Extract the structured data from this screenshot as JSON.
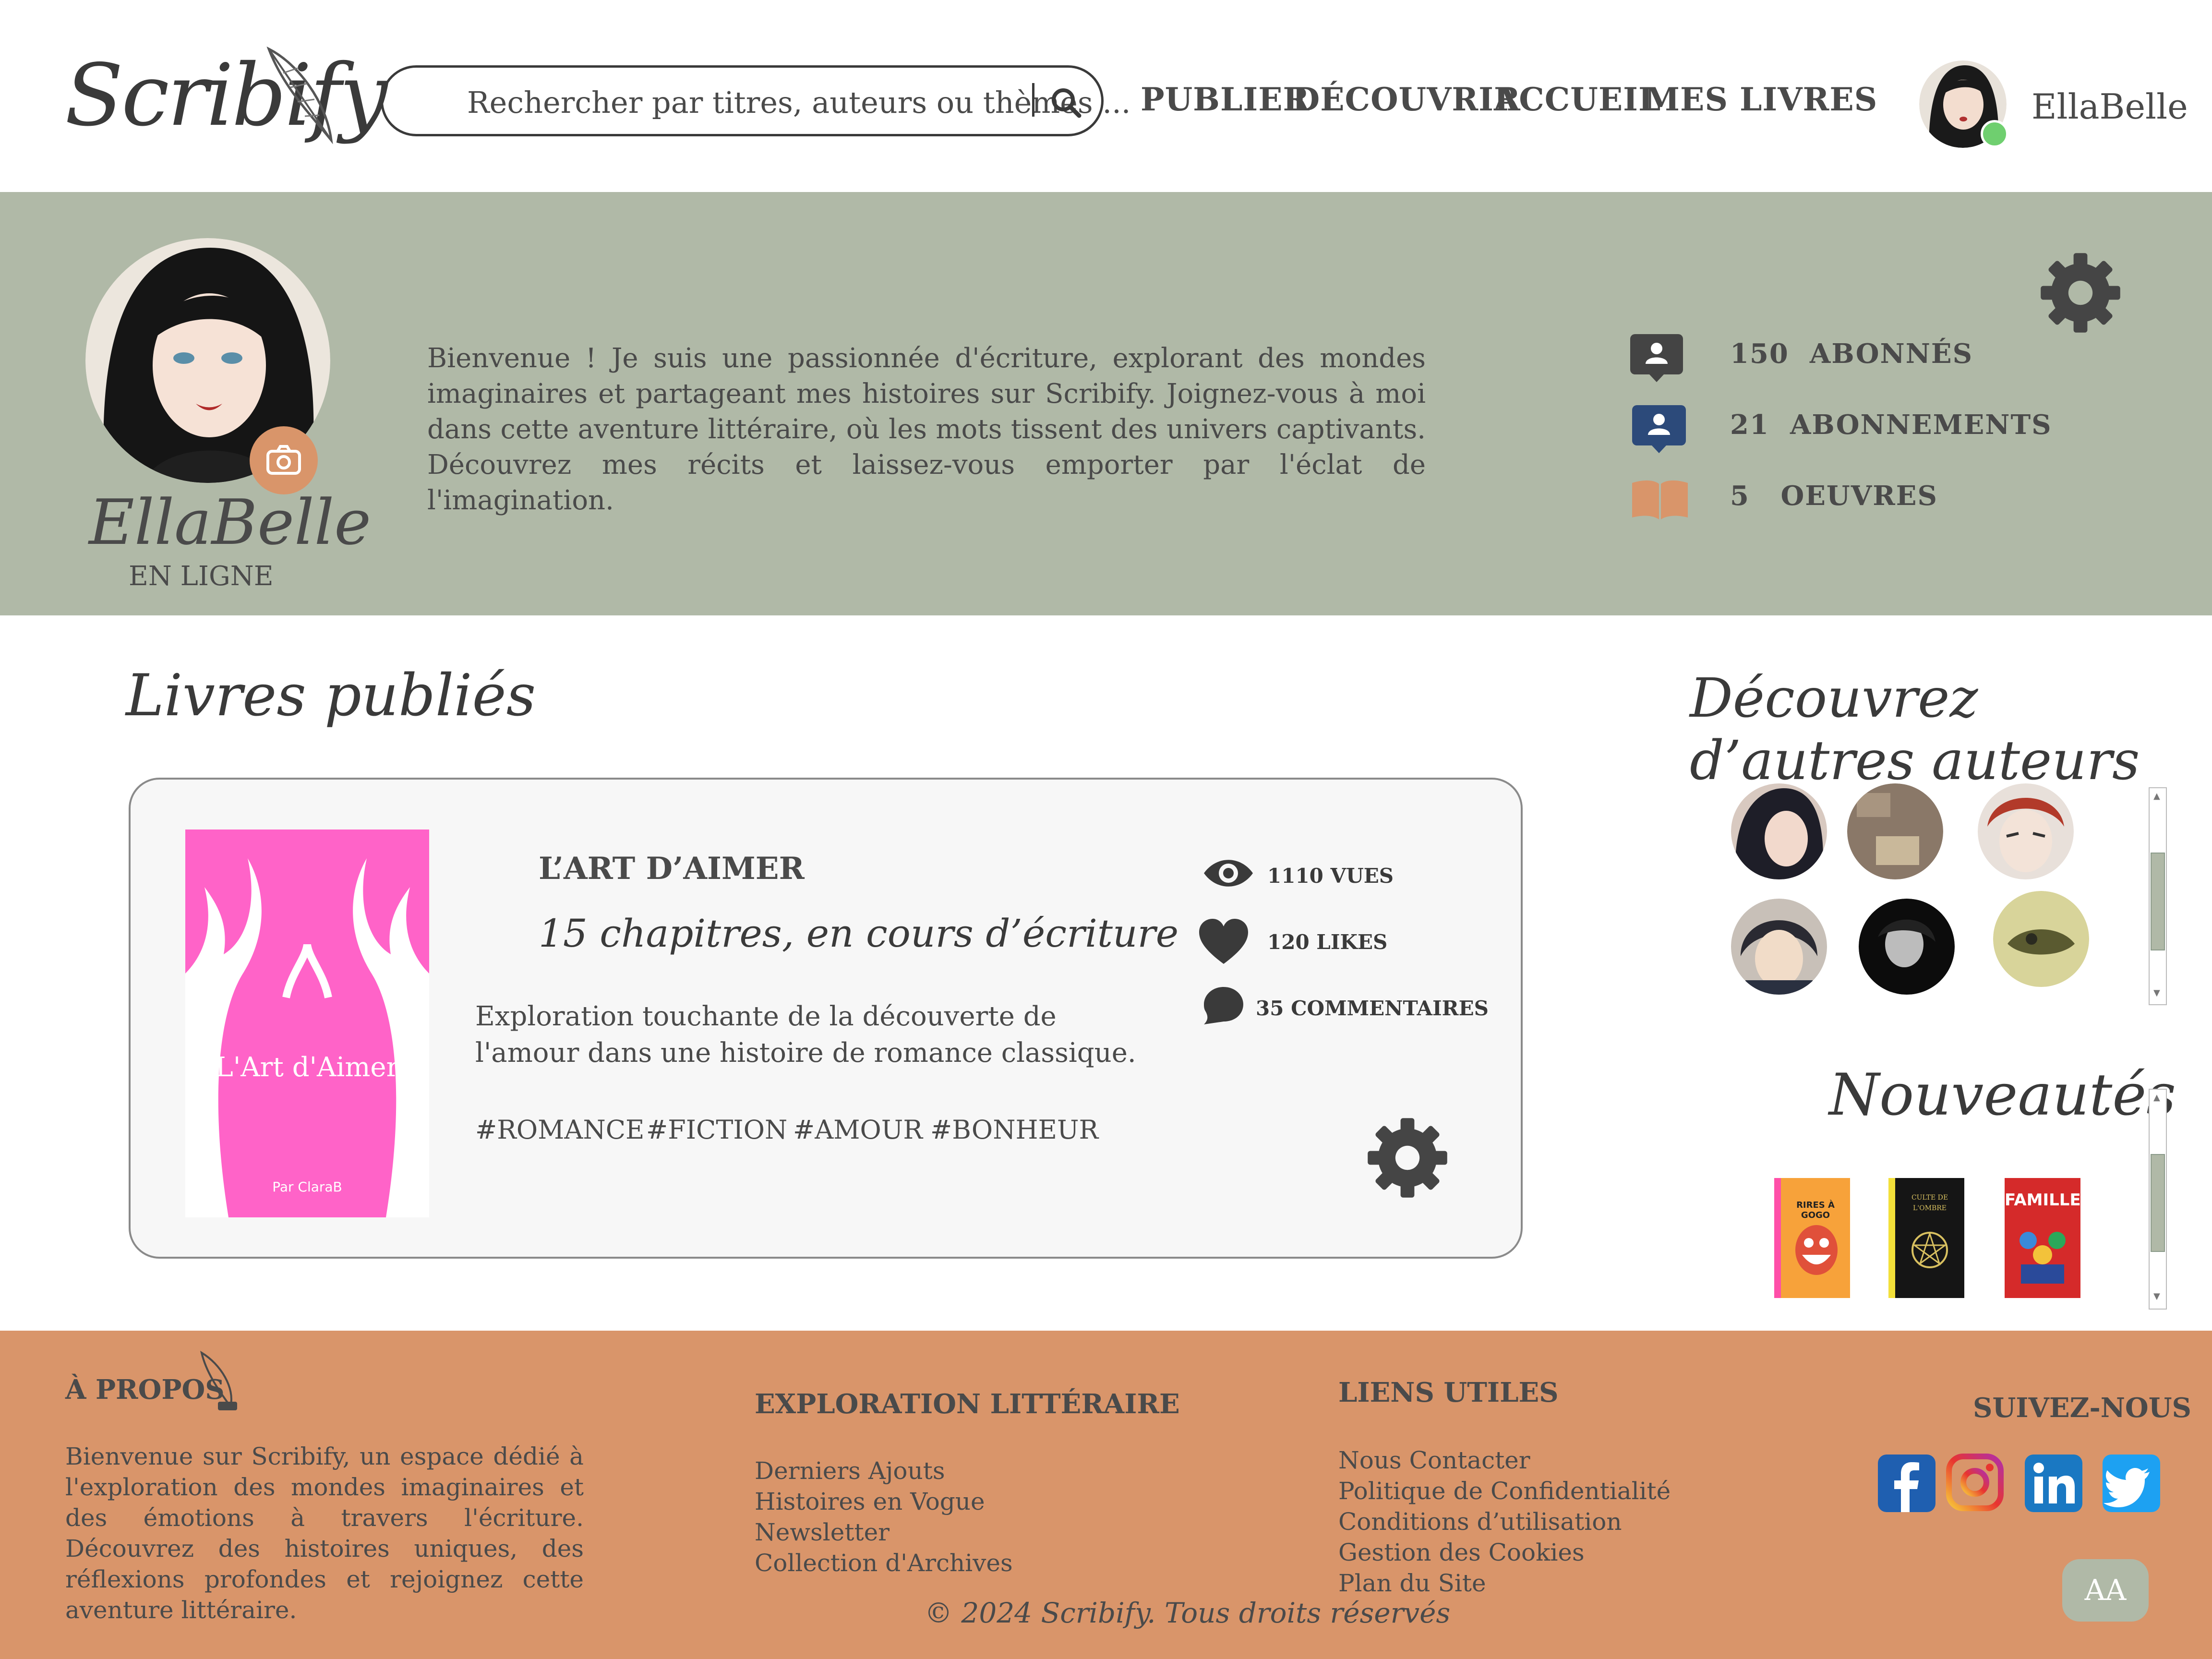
{
  "header": {
    "logo": "Scribify",
    "search_placeholder": "Rechercher par titres, auteurs ou thèmes ...",
    "nav": [
      "PUBLIER",
      "DÉCOUVRIR",
      "ACCUEIL",
      "MES LIVRES"
    ],
    "username": "EllaBelle"
  },
  "profile": {
    "name": "EllaBelle",
    "status": "EN LIGNE",
    "bio": "Bienvenue ! Je suis une passionnée d'écriture, explorant des mondes imaginaires et partageant mes histoires sur Scribify. Joignez-vous à moi dans cette aventure littéraire, où les mots tissent des univers captivants. Découvrez mes récits et laissez-vous emporter par l'éclat de l'imagination.",
    "stats": [
      {
        "value": "150",
        "label": "ABONNÉS",
        "icon": "followers-icon"
      },
      {
        "value": "21",
        "label": "ABONNEMENTS",
        "icon": "following-icon"
      },
      {
        "value": "5",
        "label": "OEUVRES",
        "icon": "book-icon"
      }
    ]
  },
  "books_section": {
    "title": "Livres publiés",
    "book": {
      "cover_title": "L'Art d'Aimer",
      "cover_author": "Par ClaraB",
      "title": "L’ART D’AIMER",
      "chapters": "15 chapitres, en cours d’écriture",
      "description": "Exploration touchante de la découverte de l'amour dans une histoire de romance classique.",
      "tags": [
        "#ROMANCE",
        "#FICTION",
        "#AMOUR",
        "#BONHEUR"
      ],
      "views": "1110 VUES",
      "likes": "120 LIKES",
      "comments": "35 COMMENTAIRES"
    }
  },
  "authors_section": {
    "title": "Découvrez d’autres auteurs"
  },
  "new_section": {
    "title": "Nouveautés",
    "books": [
      {
        "title": "RIRES À GOGO",
        "color": "#f7a23a"
      },
      {
        "title": "CULTE DE L'OMBRE",
        "color": "#151515"
      },
      {
        "title": "FAMILLE",
        "color": "#d52a2a"
      }
    ]
  },
  "footer": {
    "about_title": "À PROPOS",
    "about_text": "Bienvenue sur Scribify, un espace dédié à l'exploration des mondes imaginaires et des émotions à travers l'écriture. Découvrez des histoires uniques, des réflexions profondes et rejoignez cette aventure littéraire.",
    "explore_title": "EXPLORATION LITTÉRAIRE",
    "explore_links": [
      "Derniers Ajouts",
      "Histoires en Vogue",
      "Newsletter",
      "Collection d'Archives"
    ],
    "links_title": "LIENS UTILES",
    "useful_links": [
      "Nous Contacter",
      "Politique de Confidentialité",
      "Conditions d’utilisation",
      "Gestion des Cookies",
      "Plan du Site"
    ],
    "follow_title": "SUIVEZ-NOUS",
    "copyright": "© 2024 Scribify. Tous droits réservés",
    "aa_button": "AA"
  },
  "colors": {
    "sage": "#b0b9a7",
    "orange": "#d9956a",
    "pink": "#ff63c8",
    "dark": "#4a4a4a"
  }
}
